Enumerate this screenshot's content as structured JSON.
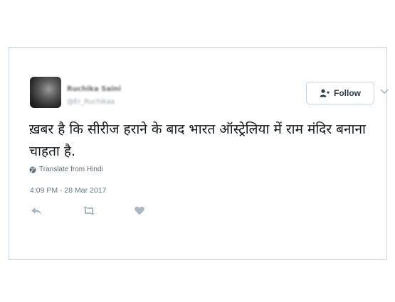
{
  "tweet": {
    "author_name": "Ruchika Saini",
    "author_handle": "@Er_Ruchikaa",
    "follow_label": "Follow",
    "text": "ख़बर है कि सीरीज हराने के बाद भारत ऑस्ट्रेलिया में राम मंदिर बनाना चाहता है.",
    "translate_label": "Translate from Hindi",
    "timestamp": "4:09 PM - 28 Mar 2017"
  },
  "icons": {
    "follow": "follow-user-icon",
    "translate": "globe-icon",
    "reply": "reply-icon",
    "retweet": "retweet-icon",
    "like": "heart-icon",
    "menu": "chevron-down-icon"
  },
  "colors": {
    "border": "#cfd6dc",
    "text": "#14171a",
    "muted": "#657786",
    "icon": "#aab8c2",
    "follow_icon": "#2a3a48"
  }
}
